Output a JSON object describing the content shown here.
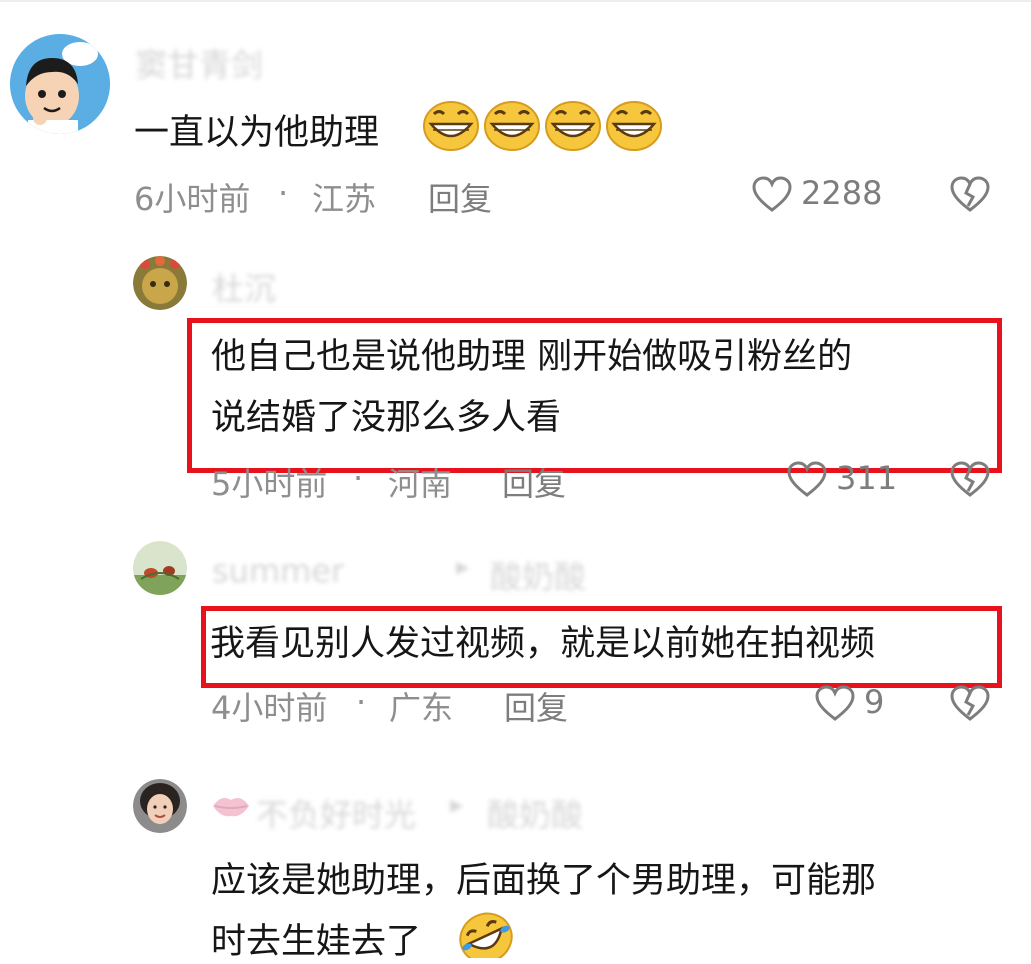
{
  "comments": [
    {
      "username": "窦甘青剑",
      "text": "一直以为他助理",
      "time": "6小时前",
      "sep": "·",
      "location": "江苏",
      "reply": "回复",
      "likes": "2288"
    },
    {
      "username": "杜沉",
      "text_line1": "他自己也是说他助理  刚开始做吸引粉丝的",
      "text_line2": "说结婚了没那么多人看",
      "time": "5小时前",
      "sep": "·",
      "location": "河南",
      "reply": "回复",
      "likes": "311"
    },
    {
      "username": "summer",
      "reply_to": "酸奶酸",
      "arrow": "▸",
      "text": "我看见别人发过视频，就是以前她在拍视频",
      "time": "4小时前",
      "sep": "·",
      "location": "广东",
      "reply": "回复",
      "likes": "9"
    },
    {
      "username": "不负好时光",
      "reply_to": "酸奶酸",
      "arrow": "▸",
      "text_line1": "应该是她助理，后面换了个男助理，可能那",
      "text_line2": "时去生娃去了"
    }
  ],
  "colors": {
    "highlight": "#e8121c",
    "meta": "#8e8e8e",
    "text": "#161616"
  }
}
